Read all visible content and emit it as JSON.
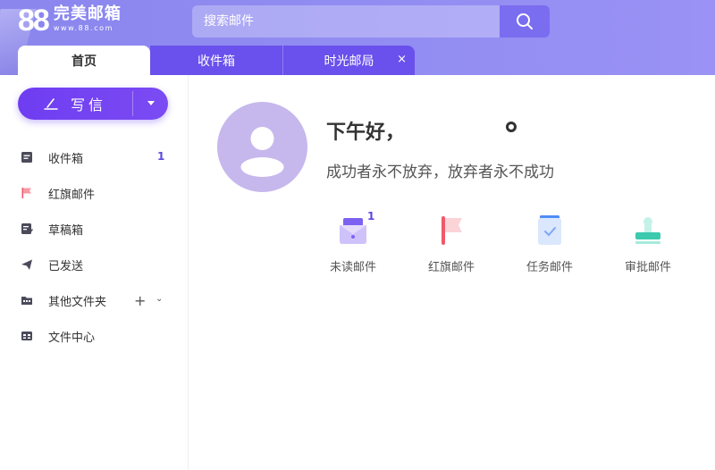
{
  "header": {
    "logo_number": "88",
    "logo_name": "完美邮箱",
    "logo_url": "www.88.com",
    "search": {
      "placeholder": "搜索邮件"
    }
  },
  "tabs": [
    {
      "label": "首页"
    },
    {
      "label": "收件箱"
    },
    {
      "label": "时光邮局",
      "close": "×"
    }
  ],
  "sidebar": {
    "compose_label": "写信",
    "items": [
      {
        "label": "收件箱",
        "icon": "inbox-icon",
        "badge": "1"
      },
      {
        "label": "红旗邮件",
        "icon": "red-flag-icon"
      },
      {
        "label": "草稿箱",
        "icon": "draft-icon"
      },
      {
        "label": "已发送",
        "icon": "sent-icon"
      },
      {
        "label": "其他文件夹",
        "icon": "folder-icon",
        "plus": "+",
        "chevron": "⌄"
      },
      {
        "label": "文件中心",
        "icon": "file-center-icon"
      }
    ]
  },
  "main": {
    "greeting": "下午好，",
    "motto": "成功者永不放弃，放弃者永不成功",
    "quick_actions": [
      {
        "label": "未读邮件",
        "icon": "unread-mail-icon",
        "badge": "1"
      },
      {
        "label": "红旗邮件",
        "icon": "red-flag-icon"
      },
      {
        "label": "任务邮件",
        "icon": "task-mail-icon"
      },
      {
        "label": "审批邮件",
        "icon": "approval-mail-icon"
      }
    ]
  },
  "colors": {
    "header_bg": "#8f8bf1",
    "accent": "#6a50ec",
    "compose": "#7045f2",
    "badge": "#5b47e0"
  }
}
